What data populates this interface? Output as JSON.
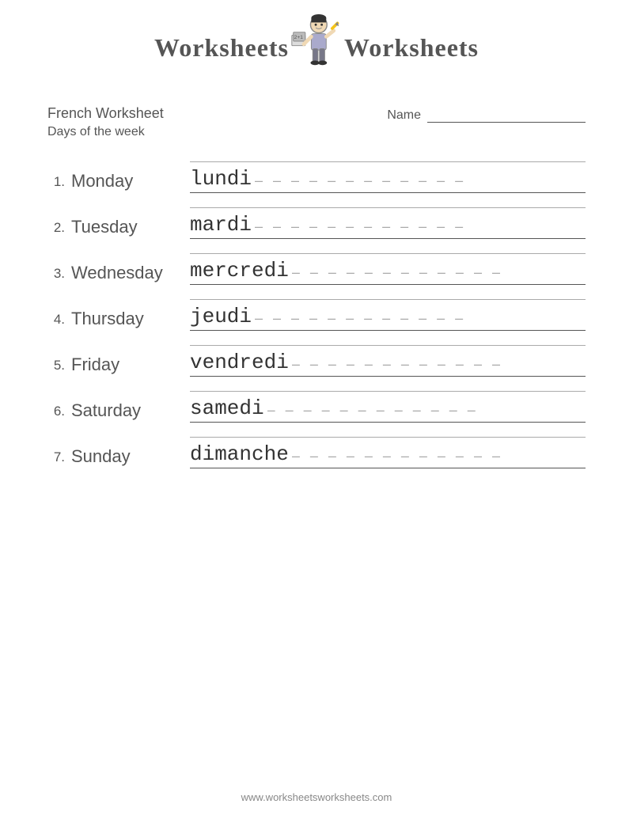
{
  "header": {
    "text_left": "Worksheets",
    "text_right": "Worksheets",
    "logo_alt": "Worksheets Worksheets logo with kid figure"
  },
  "worksheet": {
    "title": "French Worksheet",
    "subtitle": "Days of the week",
    "name_label": "Name",
    "name_placeholder": ""
  },
  "days": [
    {
      "number": "1.",
      "english": "Monday",
      "french": "lundi"
    },
    {
      "number": "2.",
      "english": "Tuesday",
      "french": "mardi"
    },
    {
      "number": "3.",
      "english": "Wednesday",
      "french": "mercredi"
    },
    {
      "number": "4.",
      "english": "Thursday",
      "french": "jeudi"
    },
    {
      "number": "5.",
      "english": "Friday",
      "french": "vendredi"
    },
    {
      "number": "6.",
      "english": "Saturday",
      "french": "samedi"
    },
    {
      "number": "7.",
      "english": "Sunday",
      "french": "dimanche"
    }
  ],
  "footer": {
    "url": "www.worksheetsworksheets.com"
  }
}
